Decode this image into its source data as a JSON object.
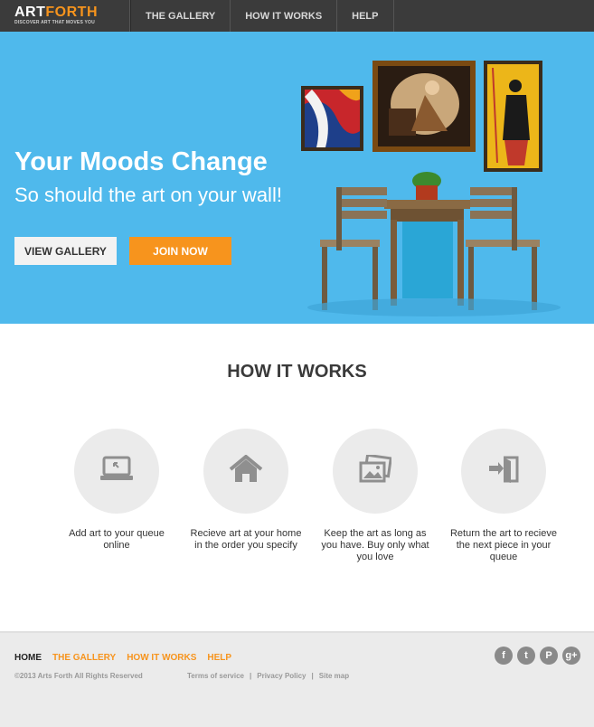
{
  "brand": {
    "name_part1": "ART",
    "name_part2": "FORTH",
    "tagline": "DISCOVER ART THAT MOVES YOU"
  },
  "nav": {
    "items": [
      {
        "label": "THE GALLERY"
      },
      {
        "label": "HOW IT WORKS"
      },
      {
        "label": "HELP"
      }
    ]
  },
  "hero": {
    "title": "Your Moods Change",
    "subtitle": "So should the art on your wall!",
    "view_gallery_label": "VIEW GALLERY",
    "join_label": "JOIN NOW"
  },
  "how_it_works": {
    "title": "HOW IT WORKS",
    "steps": [
      {
        "icon": "laptop-icon",
        "text": "Add art to your queue online"
      },
      {
        "icon": "home-icon",
        "text": "Recieve art at your home in the order you specify"
      },
      {
        "icon": "pictures-icon",
        "text": "Keep the art as long as you have. Buy only what you love"
      },
      {
        "icon": "return-door-icon",
        "text": "Return the art to recieve the next piece in your queue"
      }
    ]
  },
  "footer": {
    "nav": [
      {
        "label": "HOME"
      },
      {
        "label": "THE GALLERY"
      },
      {
        "label": "HOW IT WORKS"
      },
      {
        "label": "HELP"
      }
    ],
    "copyright": "©2013 Arts Forth All Rights Reserved",
    "legal": [
      {
        "label": "Terms of service"
      },
      {
        "label": "Privacy Policy"
      },
      {
        "label": "Site map"
      }
    ],
    "legal_separator": "|",
    "social": [
      {
        "icon": "facebook-icon",
        "glyph": "f"
      },
      {
        "icon": "twitter-icon",
        "glyph": "t"
      },
      {
        "icon": "pinterest-icon",
        "glyph": "P"
      },
      {
        "icon": "google-plus-icon",
        "glyph": "g+"
      }
    ]
  },
  "colors": {
    "accent": "#f7941d",
    "hero_bg": "#4fb9ec",
    "topbar": "#3b3b3b",
    "footer_bg": "#ebebeb"
  }
}
